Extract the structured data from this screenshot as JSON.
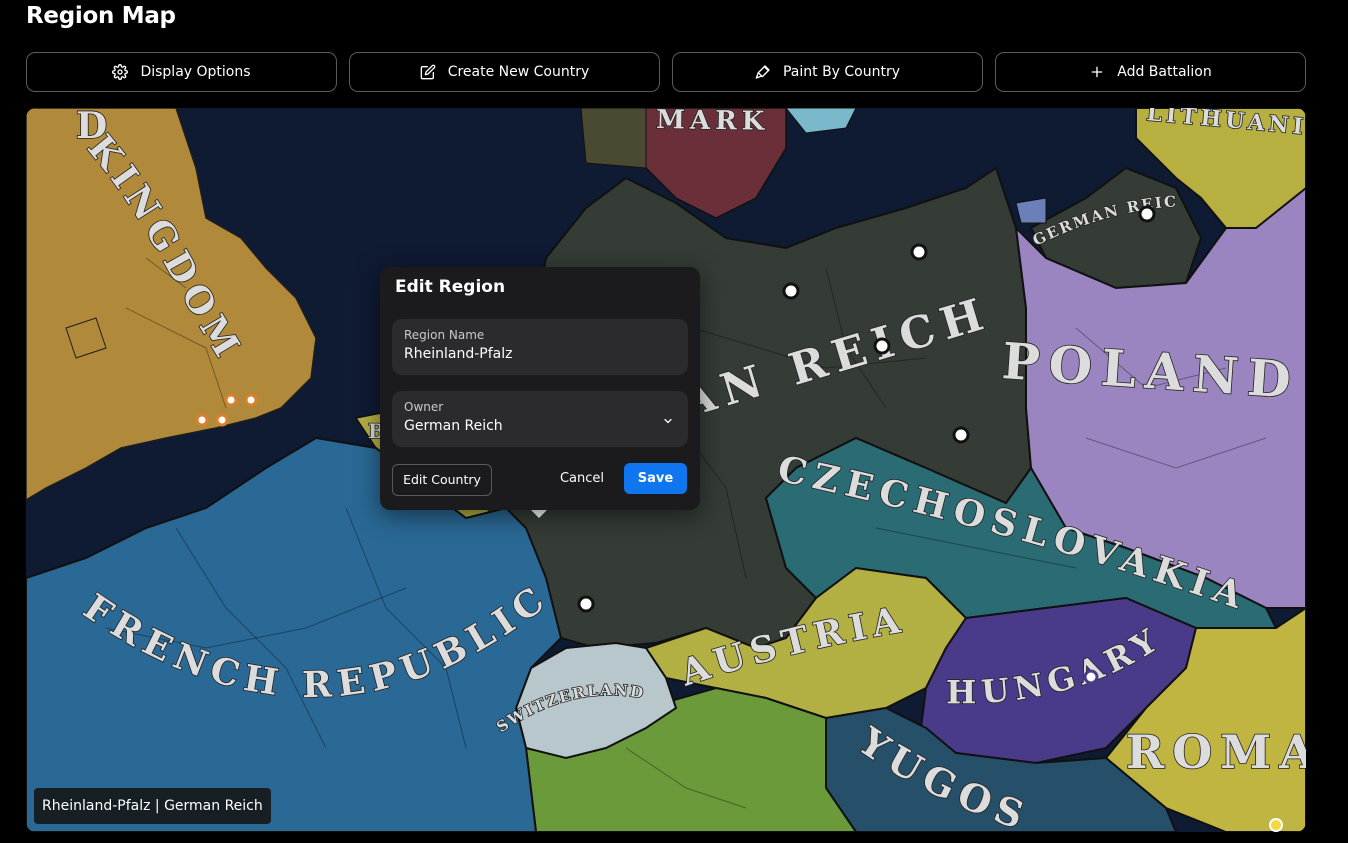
{
  "page": {
    "title": "Region Map"
  },
  "toolbar": {
    "display_options": "Display Options",
    "create_country": "Create New Country",
    "paint_by_country": "Paint By Country",
    "add_battalion": "Add Battalion"
  },
  "map": {
    "labels": {
      "united_kingdom": "KINGDOM",
      "uk_fragment": "D",
      "denmark": "MARK",
      "lithuania": "LITHUANI",
      "german_reich_small": "GERMAN REICH",
      "german_reich": "AN REICH",
      "poland": "POLAND",
      "czechoslovakia": "CZECHOSLOVAKIA",
      "french_republic": "FRENCH REPUBLIC",
      "switzerland": "SWITZERLAND",
      "austria": "AUSTRIA",
      "hungary": "HUNGARY",
      "romania": "ROMA",
      "yugoslavia": "YUGOS",
      "belgium_fragment": "B"
    },
    "colors": {
      "sea": "#0f1a33",
      "uk": "#b0893a",
      "germany": "#343c35",
      "poland": "#9b85c1",
      "czechoslovakia": "#2b6b73",
      "france": "#2a6895",
      "switzerland": "#b7c7cc",
      "austria": "#b3b043",
      "hungary": "#4a3b8a",
      "romania": "#c1b542",
      "yugoslavia": "#26506a",
      "italy": "#6b9a3a",
      "denmark": "#6b2f3a",
      "lithuania": "#b7b040"
    }
  },
  "status": {
    "hover_text": "Rheinland-Pfalz | German Reich"
  },
  "dialog": {
    "title": "Edit Region",
    "region_name_label": "Region Name",
    "region_name_value": "Rheinland-Pfalz",
    "owner_label": "Owner",
    "owner_value": "German Reich",
    "edit_country_label": "Edit Country",
    "cancel_label": "Cancel",
    "save_label": "Save"
  },
  "icons": {
    "display_options": "gear-icon",
    "create_country": "edit-icon",
    "paint_by_country": "paint-brush-icon",
    "add_battalion": "plus-icon",
    "owner_dropdown": "chevron-down-icon"
  }
}
